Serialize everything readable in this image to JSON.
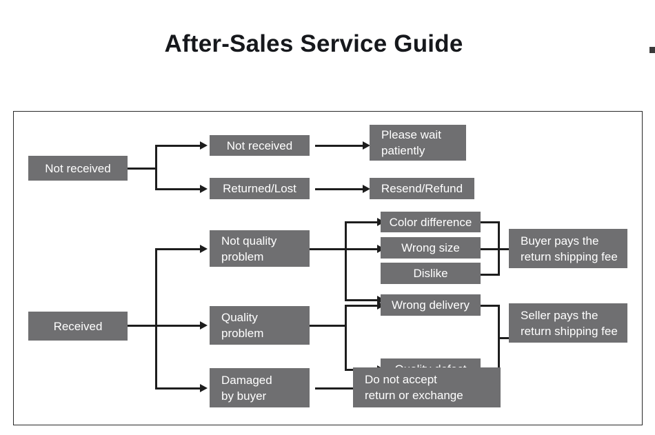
{
  "page": {
    "title": "After-Sales Service Guide",
    "box_fill_color": "#6f6f71",
    "box_text_color": "#ffffff",
    "line_color": "#1d1d1d",
    "frame_border_color": "#262626",
    "background_color": "#ffffff"
  },
  "chart_data": {
    "type": "diagram",
    "title": "After-Sales Service Guide",
    "nodes": [
      {
        "id": "not-received-root",
        "label": "Not received",
        "level": 1
      },
      {
        "id": "received-root",
        "label": "Received",
        "level": 1
      },
      {
        "id": "not-received-2",
        "label": "Not received",
        "level": 2
      },
      {
        "id": "returned-lost",
        "label": "Returned/Lost",
        "level": 2
      },
      {
        "id": "not-quality",
        "label": "Not quality\nproblem",
        "level": 2
      },
      {
        "id": "quality-problem",
        "label": "Quality\nproblem",
        "level": 2
      },
      {
        "id": "damaged-by-buyer",
        "label": "Damaged\nby buyer",
        "level": 2
      },
      {
        "id": "please-wait",
        "label": "Please wait\npatiently",
        "level": 3
      },
      {
        "id": "resend-refund",
        "label": "Resend/Refund",
        "level": 3
      },
      {
        "id": "color-difference",
        "label": "Color difference",
        "level": 3
      },
      {
        "id": "wrong-size",
        "label": "Wrong size",
        "level": 3
      },
      {
        "id": "dislike",
        "label": "Dislike",
        "level": 3
      },
      {
        "id": "wrong-delivery",
        "label": "Wrong delivery",
        "level": 3
      },
      {
        "id": "quality-defect",
        "label": "Quality defect",
        "level": 3
      },
      {
        "id": "do-not-accept",
        "label": "Do not accept\nreturn or exchange",
        "level": 3
      },
      {
        "id": "buyer-pays",
        "label": "Buyer pays the\nreturn shipping fee",
        "level": 4
      },
      {
        "id": "seller-pays",
        "label": "Seller pays the\nreturn shipping fee",
        "level": 4
      }
    ],
    "edges": [
      {
        "from": "not-received-root",
        "to": "not-received-2"
      },
      {
        "from": "not-received-root",
        "to": "returned-lost"
      },
      {
        "from": "not-received-2",
        "to": "please-wait"
      },
      {
        "from": "returned-lost",
        "to": "resend-refund"
      },
      {
        "from": "received-root",
        "to": "not-quality"
      },
      {
        "from": "received-root",
        "to": "quality-problem"
      },
      {
        "from": "received-root",
        "to": "damaged-by-buyer"
      },
      {
        "from": "not-quality",
        "to": "color-difference"
      },
      {
        "from": "not-quality",
        "to": "wrong-size"
      },
      {
        "from": "not-quality",
        "to": "dislike"
      },
      {
        "from": "quality-problem",
        "to": "wrong-delivery"
      },
      {
        "from": "quality-problem",
        "to": "quality-defect"
      },
      {
        "from": "damaged-by-buyer",
        "to": "do-not-accept"
      },
      {
        "from": "color-difference",
        "to": "buyer-pays"
      },
      {
        "from": "wrong-size",
        "to": "buyer-pays"
      },
      {
        "from": "dislike",
        "to": "buyer-pays"
      },
      {
        "from": "wrong-delivery",
        "to": "seller-pays"
      },
      {
        "from": "quality-defect",
        "to": "seller-pays"
      }
    ]
  },
  "labels": {
    "not_received_root": "Not received",
    "received_root": "Received",
    "not_received_2": "Not received",
    "returned_lost": "Returned/Lost",
    "not_quality": "Not quality\nproblem",
    "quality_problem": "Quality\nproblem",
    "damaged_by_buyer": "Damaged\nby buyer",
    "please_wait": "Please wait\npatiently",
    "resend_refund": "Resend/Refund",
    "color_difference": "Color difference",
    "wrong_size": "Wrong size",
    "dislike": "Dislike",
    "wrong_delivery": "Wrong delivery",
    "quality_defect": "Quality defect",
    "do_not_accept": "Do not accept\nreturn or exchange",
    "buyer_pays": "Buyer pays the\nreturn shipping fee",
    "seller_pays": "Seller pays the\nreturn shipping fee"
  }
}
